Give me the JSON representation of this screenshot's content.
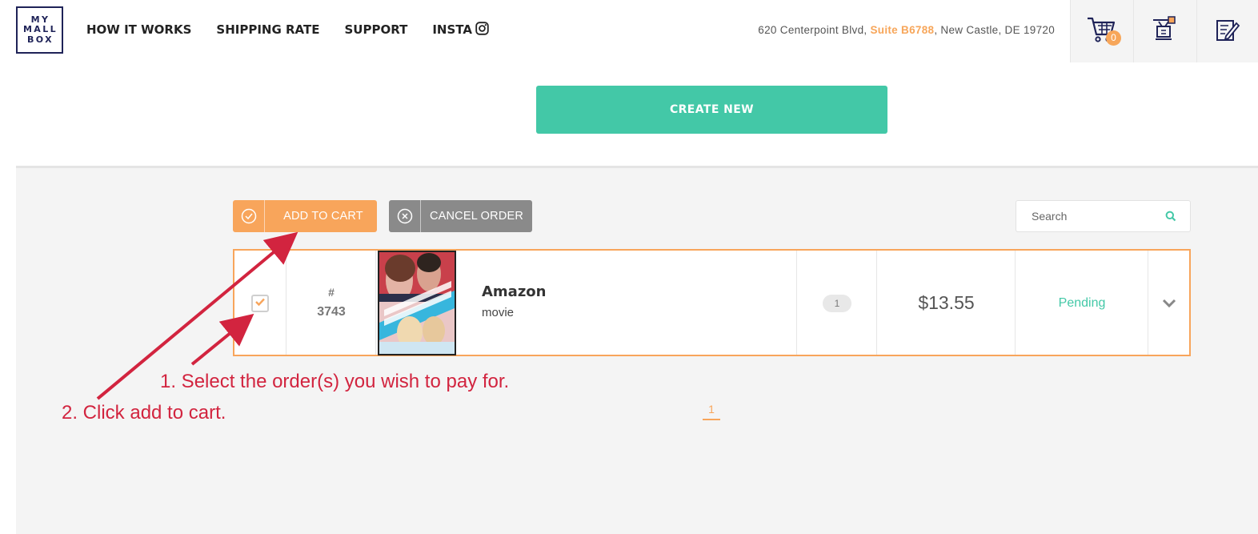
{
  "header": {
    "logo_lines": [
      "MY",
      "MALL",
      "BOX"
    ],
    "nav": [
      {
        "label": "HOW IT WORKS"
      },
      {
        "label": "SHIPPING RATE"
      },
      {
        "label": "SUPPORT"
      },
      {
        "label": "INSTA",
        "icon": "instagram-icon"
      }
    ],
    "address": {
      "street": "620 Centerpoint Blvd, ",
      "suite": "Suite B6788",
      "city": ", New Castle, DE 19720"
    },
    "cart_count": "0",
    "icons": [
      "cart-icon",
      "package-drop-icon",
      "edit-notes-icon"
    ]
  },
  "create_button": "CREATE NEW",
  "toolbar": {
    "add_to_cart": "ADD TO CART",
    "cancel_order": "CANCEL ORDER",
    "search_placeholder": "Search"
  },
  "order": {
    "checked": true,
    "hash": "#",
    "number": "3743",
    "store": "Amazon",
    "description": "movie",
    "quantity": "1",
    "price": "$13.55",
    "status": "Pending"
  },
  "pagination": {
    "current": "1"
  },
  "annotations": {
    "step1": "1. Select the order(s) you wish to pay for.",
    "step2": "2. Click add to cart."
  },
  "colors": {
    "accent_orange": "#f8a55b",
    "teal": "#43c8a7",
    "navy": "#1f2358",
    "annotation_red": "#d2243f",
    "cancel_gray": "#8a8a8a"
  }
}
